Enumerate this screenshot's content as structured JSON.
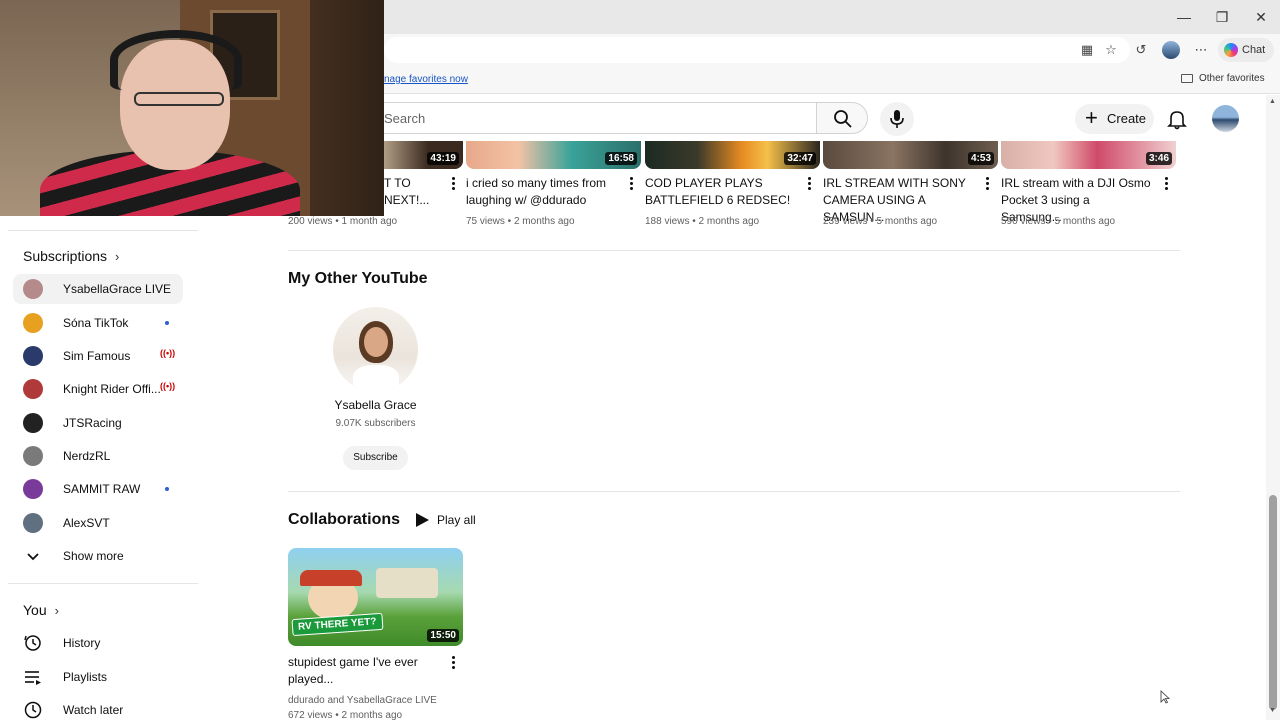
{
  "browser": {
    "favorites_prompt": "nage favorites now",
    "other_favorites": "Other favorites",
    "chat_label": "Chat"
  },
  "header": {
    "search_placeholder": "Search",
    "create_label": "Create"
  },
  "sidebar": {
    "subscriptions_title": "Subscriptions",
    "subscriptions": [
      {
        "label": "YsabellaGrace LIVE",
        "status": "none",
        "color": "#b58a8a"
      },
      {
        "label": "Sóna TikTok",
        "status": "dot",
        "color": "#e8a020"
      },
      {
        "label": "Sim Famous",
        "status": "live",
        "color": "#2a3a6a"
      },
      {
        "label": "Knight Rider Offi...",
        "status": "live",
        "color": "#b03a3a"
      },
      {
        "label": "JTSRacing",
        "status": "none",
        "color": "#222222"
      },
      {
        "label": "NerdzRL",
        "status": "none",
        "color": "#7a7a7a"
      },
      {
        "label": "SAMMIT RAW",
        "status": "dot",
        "color": "#7a3a9a"
      },
      {
        "label": "AlexSVT",
        "status": "none",
        "color": "#607080"
      }
    ],
    "show_more": "Show more",
    "you_title": "You",
    "you_items": [
      {
        "label": "History",
        "icon": "history-icon"
      },
      {
        "label": "Playlists",
        "icon": "playlists-icon"
      },
      {
        "label": "Watch later",
        "icon": "watch-later-icon"
      }
    ]
  },
  "top_videos": [
    {
      "title_line1": "T TO",
      "title_line2": "NEXT!...",
      "duration": "43:19",
      "meta": "200 views • 1 month ago"
    },
    {
      "title_line1": "i cried so many times from",
      "title_line2": "laughing w/ @ddurado",
      "duration": "16:58",
      "meta": "75 views • 2 months ago"
    },
    {
      "title_line1": "COD PLAYER PLAYS",
      "title_line2": "BATTLEFIELD 6 REDSEC!",
      "duration": "32:47",
      "meta": "188 views • 2 months ago"
    },
    {
      "title_line1": "IRL STREAM WITH SONY",
      "title_line2": "CAMERA USING A SAMSUN...",
      "duration": "4:53",
      "meta": "239 views • 5 months ago"
    },
    {
      "title_line1": "IRL stream with a DJI Osmo",
      "title_line2": "Pocket 3 using a Samsung...",
      "duration": "3:46",
      "meta": "590 views • 5 months ago"
    }
  ],
  "other_channel": {
    "section_title": "My Other YouTube",
    "name": "Ysabella Grace",
    "subscribers": "9.07K subscribers",
    "subscribe_label": "Subscribe"
  },
  "collaborations": {
    "section_title": "Collaborations",
    "play_all": "Play all",
    "video": {
      "title_line1": "stupidest game I've ever",
      "title_line2": "played...",
      "duration": "15:50",
      "thumb_text": "RV THERE YET?",
      "authors": "ddurado and YsabellaGrace LIVE",
      "meta": "672 views • 2 months ago"
    }
  }
}
